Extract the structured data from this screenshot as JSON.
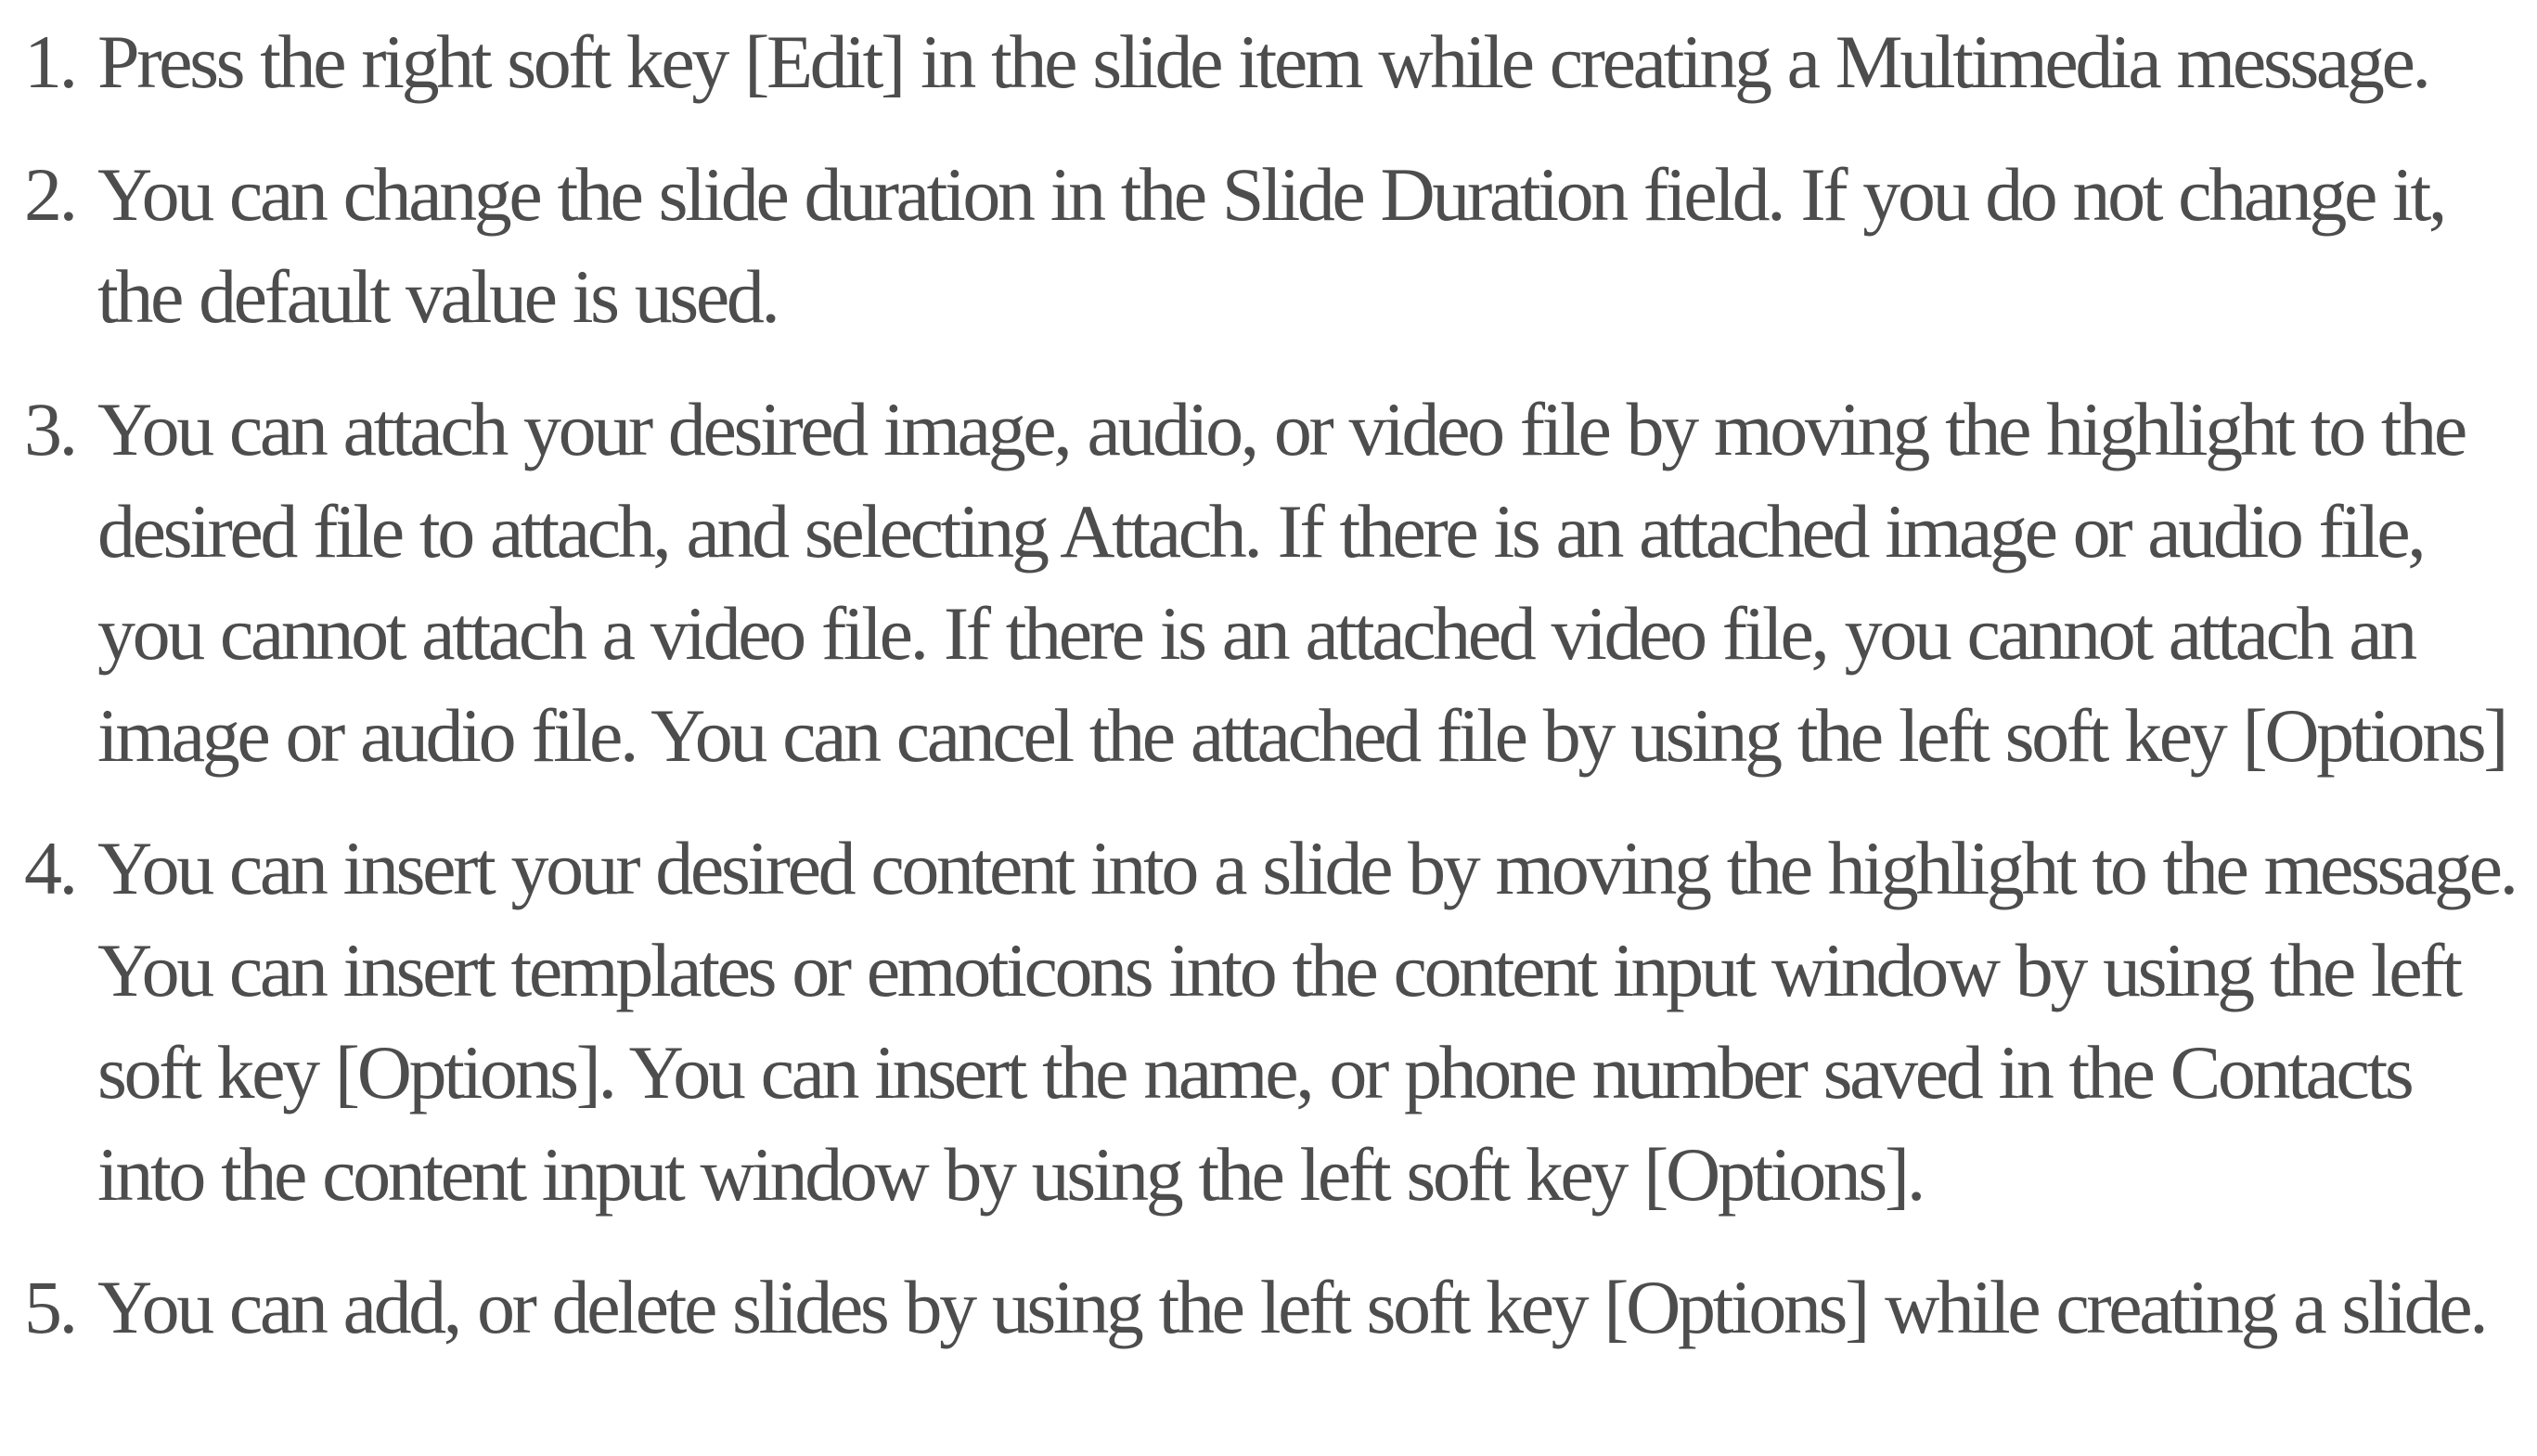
{
  "steps": [
    {
      "number": "1.",
      "text": "Press the right soft key [Edit] in the slide item while creating a Multimedia message."
    },
    {
      "number": "2.",
      "text": "You can change the slide duration in the Slide Duration field. If you do not change it, the default value is used."
    },
    {
      "number": "3.",
      "text": "You can attach your desired image, audio, or video file by moving the highlight to the desired file to attach, and selecting Attach. If there is an attached image or audio file, you cannot attach a video file. If there is an attached video file, you cannot attach an image or audio file. You can cancel the attached file by using the left soft key [Options]"
    },
    {
      "number": "4.",
      "text": "You can insert your desired content into a slide by moving the highlight to the message. You can insert templates or emoticons into the content input window by using the left soft key [Options]. You can insert the name, or phone number saved in the Contacts into the content input window by using the left soft key [Options]."
    },
    {
      "number": "5.",
      "text": "You can add, or delete slides by using the left soft key [Options] while creating a slide."
    }
  ]
}
